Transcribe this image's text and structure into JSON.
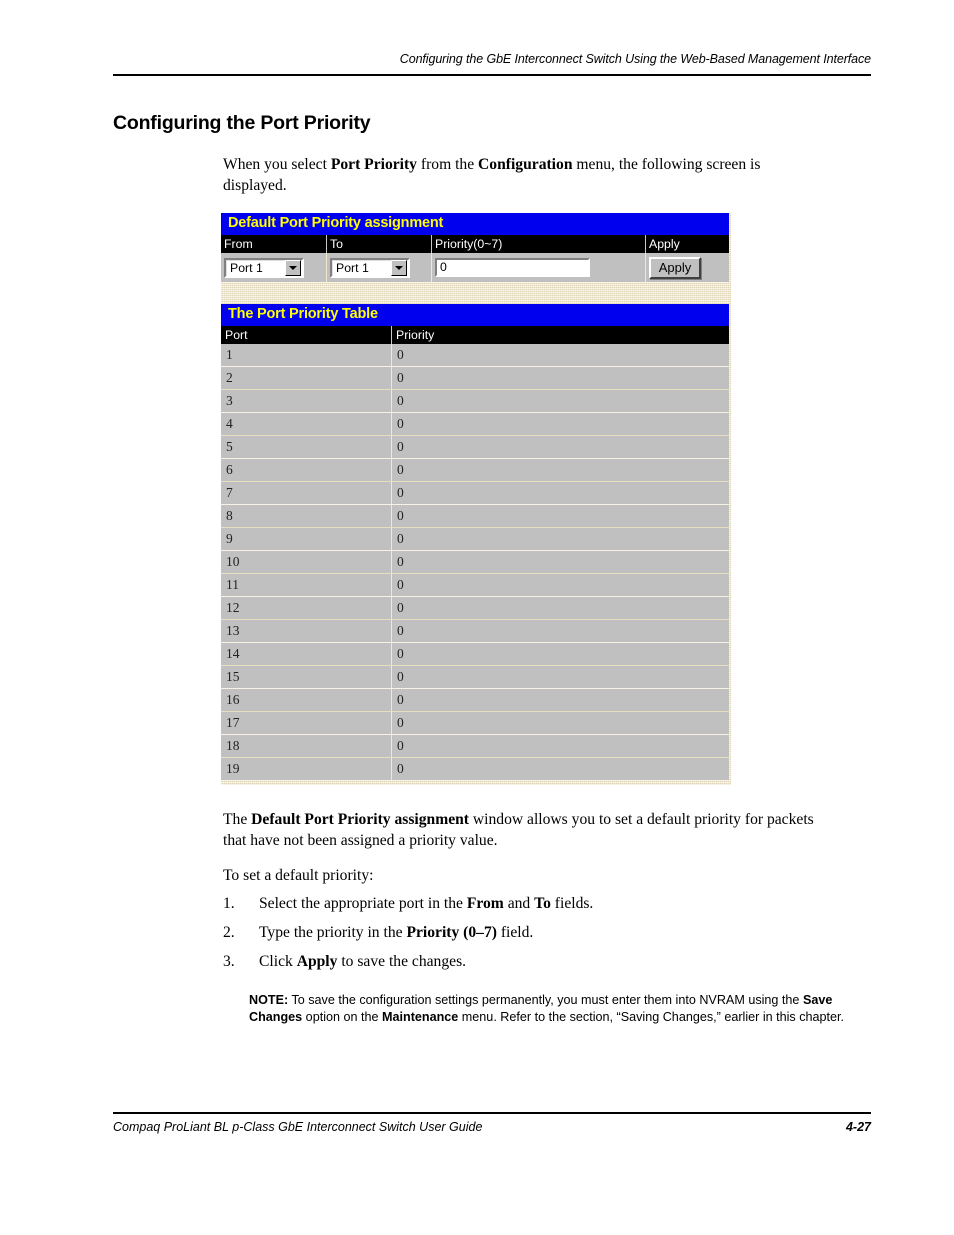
{
  "document": {
    "running_head": "Configuring the GbE Interconnect Switch Using the Web-Based Management Interface",
    "heading": "Configuring the Port Priority",
    "footer_left": "Compaq ProLiant BL p-Class GbE Interconnect Switch User Guide",
    "footer_right": "4-27"
  },
  "paragraphs": {
    "intro_part1": "When you select ",
    "intro_bold1": "Port Priority",
    "intro_part2": " from the ",
    "intro_bold2": "Configuration",
    "intro_part3": " menu, the following screen is displayed.",
    "desc_part1": "The ",
    "desc_bold1": "Default Port Priority assignment",
    "desc_part2": " window allows you to set a default priority for packets that have not been assigned a priority value.",
    "to_set": "To set a default priority:"
  },
  "steps": [
    {
      "num": "1.",
      "part1": "Select the appropriate port in the ",
      "bold1": "From",
      "part2": " and ",
      "bold2": "To",
      "part3": " fields."
    },
    {
      "num": "2.",
      "part1": "Type the priority in the ",
      "bold1": "Priority (0–7)",
      "part2": " field.",
      "bold2": "",
      "part3": ""
    },
    {
      "num": "3.",
      "part1": "Click ",
      "bold1": "Apply",
      "part2": " to save the changes.",
      "bold2": "",
      "part3": ""
    }
  ],
  "note": {
    "label": "NOTE:",
    "text_part1": " To save the configuration settings permanently, you must enter them into NVRAM using the ",
    "bold1": "Save Changes",
    "text_part2": " option on the ",
    "bold2": "Maintenance",
    "text_part3": " menu. Refer to the section, “Saving Changes,” earlier in this chapter."
  },
  "screenshot": {
    "assignment_panel": {
      "title": "Default Port Priority assignment",
      "columns": [
        "From",
        "To",
        "Priority(0~7)",
        "Apply"
      ],
      "from_select_value": "Port 1",
      "to_select_value": "Port 1",
      "priority_input_value": "0",
      "apply_button_label": "Apply"
    },
    "table_panel": {
      "title": "The Port Priority Table",
      "columns": [
        "Port",
        "Priority"
      ],
      "rows": [
        {
          "port": "1",
          "priority": "0"
        },
        {
          "port": "2",
          "priority": "0"
        },
        {
          "port": "3",
          "priority": "0"
        },
        {
          "port": "4",
          "priority": "0"
        },
        {
          "port": "5",
          "priority": "0"
        },
        {
          "port": "6",
          "priority": "0"
        },
        {
          "port": "7",
          "priority": "0"
        },
        {
          "port": "8",
          "priority": "0"
        },
        {
          "port": "9",
          "priority": "0"
        },
        {
          "port": "10",
          "priority": "0"
        },
        {
          "port": "11",
          "priority": "0"
        },
        {
          "port": "12",
          "priority": "0"
        },
        {
          "port": "13",
          "priority": "0"
        },
        {
          "port": "14",
          "priority": "0"
        },
        {
          "port": "15",
          "priority": "0"
        },
        {
          "port": "16",
          "priority": "0"
        },
        {
          "port": "17",
          "priority": "0"
        },
        {
          "port": "18",
          "priority": "0"
        },
        {
          "port": "19",
          "priority": "0"
        }
      ]
    },
    "colors": {
      "panel_header_bg": "#0000ee",
      "panel_header_text": "#ffff00",
      "column_header_bg": "#000000",
      "column_header_text": "#ffffff",
      "row_bg": "#c0c0c0",
      "page_bg": "#efe8cd"
    }
  }
}
